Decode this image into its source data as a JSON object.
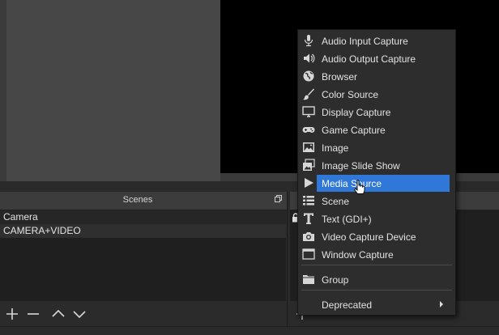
{
  "scenes": {
    "title": "Scenes",
    "items": [
      "Camera",
      "CAMERA+VIDEO"
    ],
    "toolbar": [
      {
        "icon": "plus-icon"
      },
      {
        "icon": "minus-icon"
      },
      {
        "icon": "chevron-up-icon"
      },
      {
        "icon": "chevron-down-icon"
      }
    ]
  },
  "context_menu": {
    "items": [
      {
        "label": "Audio Input Capture",
        "icon": "microphone-icon"
      },
      {
        "label": "Audio Output Capture",
        "icon": "speaker-icon"
      },
      {
        "label": "Browser",
        "icon": "globe-icon"
      },
      {
        "label": "Color Source",
        "icon": "paintbrush-icon"
      },
      {
        "label": "Display Capture",
        "icon": "monitor-icon"
      },
      {
        "label": "Game Capture",
        "icon": "gamepad-icon"
      },
      {
        "label": "Image",
        "icon": "image-icon"
      },
      {
        "label": "Image Slide Show",
        "icon": "slideshow-icon"
      },
      {
        "label": "Media Source",
        "icon": "play-icon",
        "selected": true
      },
      {
        "label": "Scene",
        "icon": "list-icon"
      },
      {
        "label": "Text (GDI+)",
        "icon": "text-icon"
      },
      {
        "label": "Video Capture Device",
        "icon": "camera-icon"
      },
      {
        "label": "Window Capture",
        "icon": "window-icon"
      },
      {
        "label": "Group",
        "icon": "folder-icon"
      },
      {
        "label": "Deprecated",
        "icon": "",
        "submenu": true
      }
    ]
  },
  "colors": {
    "selection": "#2f78d7",
    "menu_bg": "#2d2d2d",
    "panel_bg": "#2b2b2b",
    "list_bg": "#1f1f1f",
    "preview_black": "#000000"
  }
}
